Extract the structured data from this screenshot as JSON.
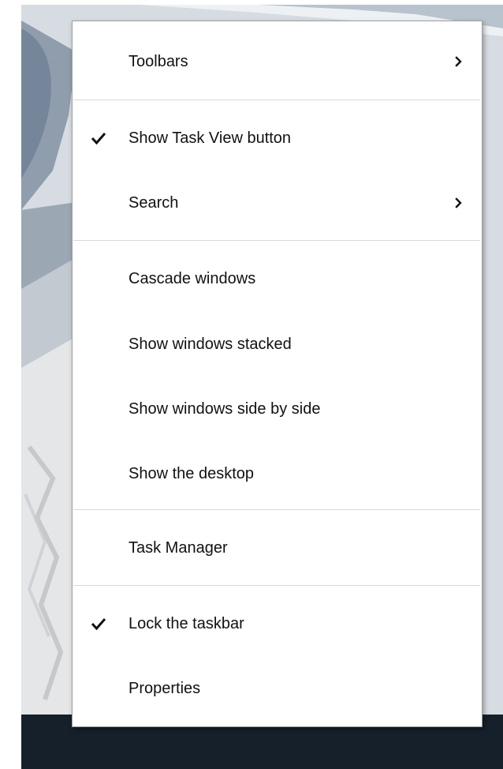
{
  "desktop": {
    "taskbar_color": "#16202b"
  },
  "context_menu": {
    "items": [
      {
        "label": "Toolbars",
        "checked": false,
        "submenu": true,
        "icon": "chevron-right-icon"
      },
      {
        "label": "Show Task View button",
        "checked": true,
        "submenu": false,
        "icon": "check-icon"
      },
      {
        "label": "Search",
        "checked": false,
        "submenu": true,
        "icon": "chevron-right-icon"
      },
      {
        "label": "Cascade windows",
        "checked": false,
        "submenu": false
      },
      {
        "label": "Show windows stacked",
        "checked": false,
        "submenu": false
      },
      {
        "label": "Show windows side by side",
        "checked": false,
        "submenu": false
      },
      {
        "label": "Show the desktop",
        "checked": false,
        "submenu": false
      },
      {
        "label": "Task Manager",
        "checked": false,
        "submenu": false
      },
      {
        "label": "Lock the taskbar",
        "checked": true,
        "submenu": false,
        "icon": "check-icon"
      },
      {
        "label": "Properties",
        "checked": false,
        "submenu": false
      }
    ]
  }
}
